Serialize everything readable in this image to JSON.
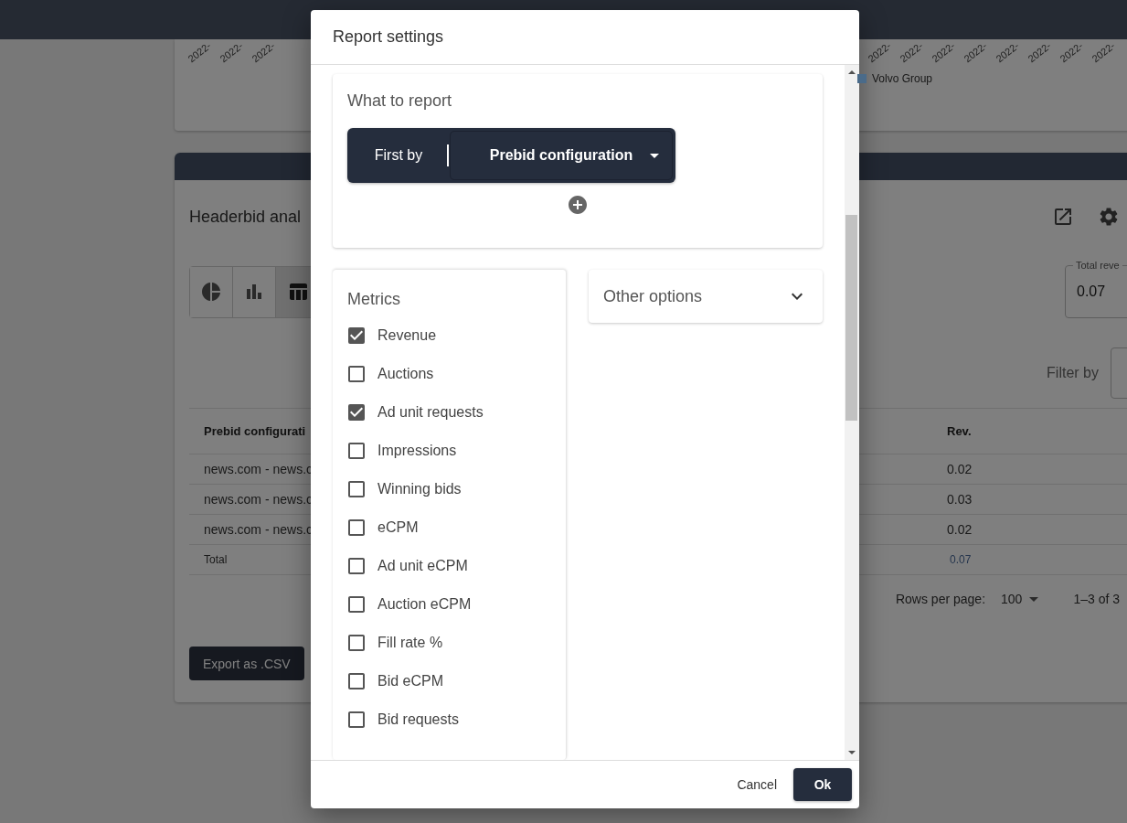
{
  "background": {
    "chart_card": {
      "x_ticks_left": [
        "2022-",
        "2022-",
        "2022-"
      ],
      "x_ticks_right": [
        "2022-",
        "2022-",
        "2022-",
        "2022-",
        "2022-",
        "2022-",
        "2022-",
        "2022-"
      ],
      "legend": [
        {
          "label": "Volvo Group",
          "color": "#4a6b8a"
        }
      ]
    },
    "report_card": {
      "title": "Headerbid anal",
      "view_toggles": [
        {
          "kind": "pie",
          "selected": false
        },
        {
          "kind": "bar",
          "selected": false
        },
        {
          "kind": "table",
          "selected": true
        }
      ],
      "total_field": {
        "label": "Total reve",
        "value": "0.07"
      },
      "filter_label": "Filter by",
      "table": {
        "columns": [
          "Prebid configurati",
          "Rev."
        ],
        "rows": [
          [
            "news.com - news.c",
            "0.02"
          ],
          [
            "news.com - news.c",
            "0.03"
          ],
          [
            "news.com - news.c",
            "0.02"
          ]
        ],
        "total": [
          "Total",
          "0.07"
        ]
      },
      "pagination": {
        "rows_per_page_label": "Rows per page:",
        "rows_per_page": "100",
        "range": "1–3 of 3"
      },
      "export_button": "Export as .CSV"
    }
  },
  "dialog": {
    "title": "Report settings",
    "what_to_report": {
      "title": "What to report",
      "group_label": "First by",
      "group_value": "Prebid configuration"
    },
    "metrics": {
      "title": "Metrics",
      "items": [
        {
          "label": "Revenue",
          "checked": true
        },
        {
          "label": "Auctions",
          "checked": false
        },
        {
          "label": "Ad unit requests",
          "checked": true
        },
        {
          "label": "Impressions",
          "checked": false
        },
        {
          "label": "Winning bids",
          "checked": false
        },
        {
          "label": "eCPM",
          "checked": false
        },
        {
          "label": "Ad unit eCPM",
          "checked": false
        },
        {
          "label": "Auction eCPM",
          "checked": false
        },
        {
          "label": "Fill rate %",
          "checked": false
        },
        {
          "label": "Bid eCPM",
          "checked": false
        },
        {
          "label": "Bid requests",
          "checked": false
        }
      ]
    },
    "other_options": {
      "title": "Other options",
      "expanded": false
    },
    "buttons": {
      "cancel": "Cancel",
      "ok": "Ok"
    }
  }
}
